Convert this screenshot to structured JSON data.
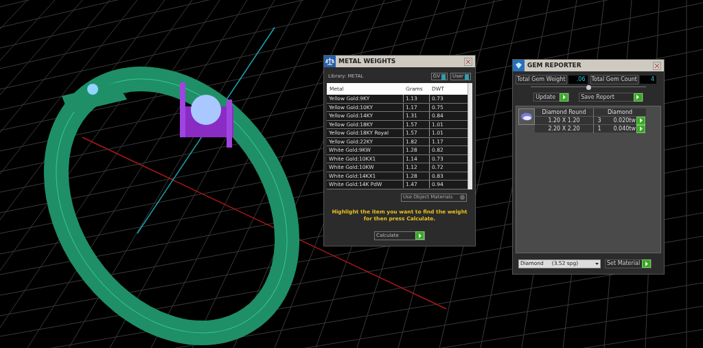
{
  "metal_weights": {
    "title": "METAL WEIGHTS",
    "library": "Library: METAL",
    "toggles": [
      {
        "label": "GV",
        "on": true
      },
      {
        "label": "User",
        "on": true
      }
    ],
    "columns": [
      "Metal",
      "Grams",
      "DWT"
    ],
    "rows": [
      {
        "metal": "Yellow Gold:9KY",
        "grams": "1.13",
        "dwt": "0.73"
      },
      {
        "metal": "Yellow Gold:10KY",
        "grams": "1.17",
        "dwt": "0.75"
      },
      {
        "metal": "Yellow Gold:14KY",
        "grams": "1.31",
        "dwt": "0.84"
      },
      {
        "metal": "Yellow Gold:18KY",
        "grams": "1.57",
        "dwt": "1.01"
      },
      {
        "metal": "Yellow Gold:18KY Royal",
        "grams": "1.57",
        "dwt": "1.01"
      },
      {
        "metal": "Yellow Gold:22KY",
        "grams": "1.82",
        "dwt": "1.17"
      },
      {
        "metal": "White Gold:9KW",
        "grams": "1.28",
        "dwt": "0.82"
      },
      {
        "metal": "White Gold:10KX1",
        "grams": "1.14",
        "dwt": "0.73"
      },
      {
        "metal": "White Gold:10KW",
        "grams": "1.12",
        "dwt": "0.72"
      },
      {
        "metal": "White Gold:14KX1",
        "grams": "1.28",
        "dwt": "0.83"
      },
      {
        "metal": "White Gold:14K PdW",
        "grams": "1.47",
        "dwt": "0.94"
      }
    ],
    "use_object_materials": {
      "label": "Use Object Materials",
      "checked": false
    },
    "hint": "Highlight the item you want to find the weight for then press Calculate.",
    "calculate": "Calculate"
  },
  "gem_reporter": {
    "title": "GEM REPORTER",
    "total_weight_label": "Total Gem Weight",
    "total_weight": ".06",
    "total_count_label": "Total Gem Count",
    "total_count": "4",
    "update": "Update",
    "save_report": "Save Report",
    "gem": {
      "name": "Diamond Round",
      "material": "Diamond",
      "sizes": [
        {
          "size": "1.20 X 1.20",
          "count": "3",
          "weight": "0.020tw"
        },
        {
          "size": "2.20 X 2.20",
          "count": "1",
          "weight": "0.040tw"
        }
      ]
    },
    "material_select": "Diamond     (3.52 spg)",
    "set_material": "Set Material"
  }
}
